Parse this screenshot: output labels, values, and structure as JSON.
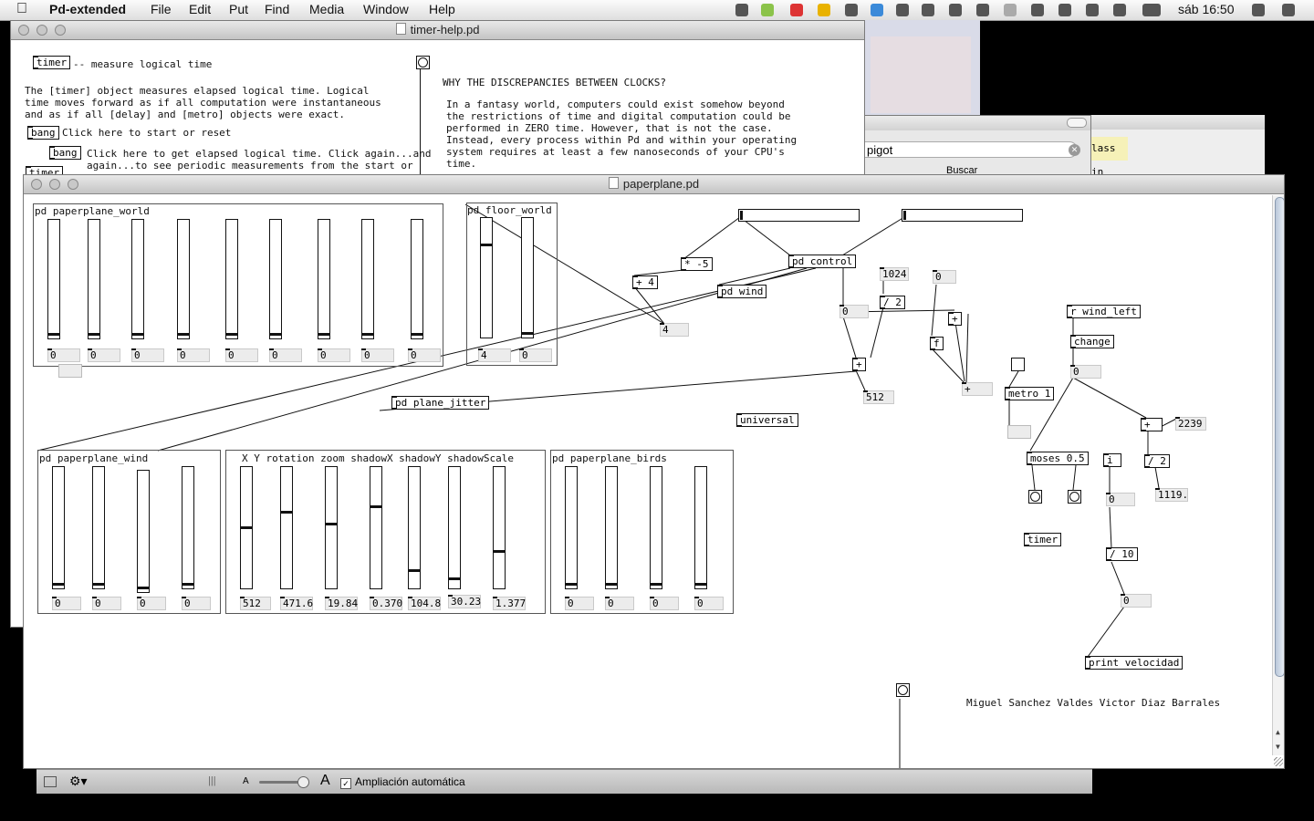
{
  "menubar": {
    "app": "Pd-extended",
    "items": [
      "File",
      "Edit",
      "Put",
      "Find",
      "Media",
      "Window",
      "Help"
    ],
    "clock": "sáb 16:50"
  },
  "help_window": {
    "title": "timer-help.pd",
    "obj_timer": "timer",
    "desc": "-- measure logical time",
    "p1": "The [timer] object measures elapsed logical time. Logical",
    "p2": "time moves forward as if all computation were instantaneous",
    "p3": "and as if all [delay] and [metro] objects were exact.",
    "msg_bang": "bang",
    "click_reset": "Click here to start or reset",
    "msg_bang2": "bang",
    "click_get": "Click here to get elapsed logical time. Click again...and",
    "again": "again...to see periodic measurements from the start or",
    "obj_timer2": "timer",
    "why": "WHY THE DISCREPANCIES BETWEEN CLOCKS?",
    "w1": "In a fantasy world, computers could exist somehow beyond",
    "w2": "the restrictions of time and digital computation could be",
    "w3": "performed in ZERO time. However, that is not the case.",
    "w4": "Instead, every process within Pd and within your operating",
    "w5": "system requires at least a few nanoseconds of your CPU's",
    "w6": "time."
  },
  "search_window": {
    "query": "pigot",
    "button": "Buscar",
    "snippet": "lass in"
  },
  "main_window": {
    "title": "paperplane.pd",
    "sp_world": {
      "label": "pd paperplane_world",
      "sliders": [
        0.02,
        0.02,
        0.02,
        0.02,
        0.02,
        0.02,
        0.02,
        0.02,
        0.02
      ],
      "nums": [
        "0",
        "0",
        "0",
        "0",
        "0",
        "0",
        "0",
        "0",
        "0"
      ]
    },
    "sp_floor": {
      "label": "pd floor_world",
      "sliders": [
        0.78,
        0.02
      ],
      "nums": [
        "4",
        "0"
      ]
    },
    "sp_wind": {
      "label": "pd paperplane_wind",
      "sliders": [
        0.02,
        0.02,
        0.02,
        0.02
      ],
      "nums": [
        "0",
        "0",
        "0",
        "0"
      ]
    },
    "sp_xy": {
      "label": "X Y rotation zoom shadowX shadowY shadowScale",
      "sliders": [
        0.5,
        0.63,
        0.53,
        0.68,
        0.14,
        0.07,
        0.3
      ],
      "nums": [
        "512",
        "471.6",
        "19.84",
        "0.370",
        "104.8",
        "30.23",
        "1.377"
      ]
    },
    "sp_birds": {
      "label": "pd paperplane_birds",
      "sliders": [
        0.02,
        0.02,
        0.02,
        0.02
      ],
      "nums": [
        "0",
        "0",
        "0",
        "0"
      ]
    },
    "o_times": "* -5",
    "o_control": "pd control",
    "o_plus4": "+ 4",
    "o_pdwind": "pd wind",
    "n_4": "4",
    "n_1024": "1024",
    "o_div2": "/ 2",
    "n_0a": "0",
    "n_0b": "0",
    "o_plus": "+",
    "n_512": "512",
    "o_plusb": "+",
    "o_f": "f",
    "o_plusc": "+",
    "o_jitter": "pd plane_jitter",
    "o_universal": "universal",
    "o_rwind": "r wind_left",
    "o_change": "change",
    "n_0c": "0",
    "o_metro": "metro 1",
    "o_plusd": "+",
    "n_2239": "2239",
    "o_moses": "moses 0.5",
    "o_i": "i",
    "o_div2b": "/ 2",
    "n_1119": "1119.",
    "n_0d": "0",
    "o_timer": "timer",
    "o_div10": "/ 10",
    "n_0e": "0",
    "o_print": "print velocidad",
    "credits": "Miguel Sanchez Valdes Victor Diaz Barrales"
  },
  "finder_bar": {
    "zoom_a": "A",
    "zoom_A": "A",
    "checkbox_label": "Ampliación automática"
  }
}
